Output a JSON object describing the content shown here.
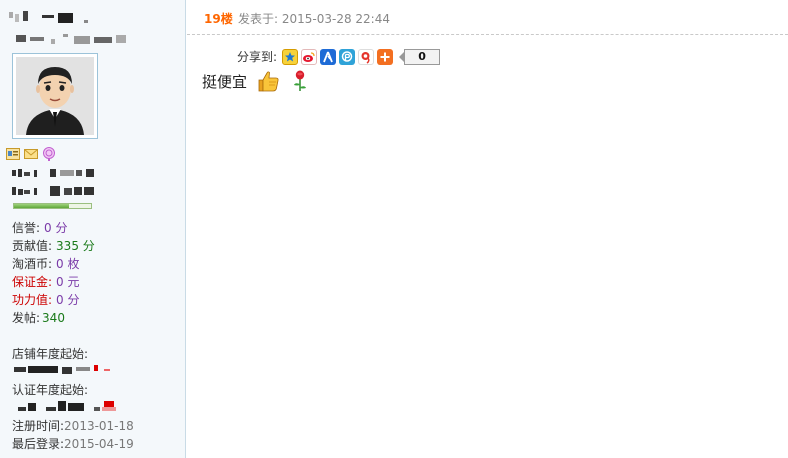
{
  "post": {
    "floor": "19楼",
    "posted_at": "发表于: 2015-03-28 22:44",
    "share_label": "分享到:",
    "share_count": "0",
    "share_icons": [
      "qzone-icon",
      "weibo-icon",
      "renren-icon",
      "pengyou-icon",
      "kaixin-icon",
      "more-share-icon"
    ],
    "content": "挺便宜",
    "emoticons": [
      "thumbs-up-icon",
      "rose-icon"
    ]
  },
  "user": {
    "stats": [
      {
        "key": "信誉:",
        "value": "0 分",
        "style": "normal"
      },
      {
        "key": "贡献值:",
        "value": "335 分",
        "style": "green"
      },
      {
        "key": "淘酒币:",
        "value": "0 枚",
        "style": "normal"
      },
      {
        "key": "保证金:",
        "value": "0 元",
        "style": "red"
      },
      {
        "key": "功力值:",
        "value": "0 分",
        "style": "red"
      },
      {
        "key": "发帖:",
        "value": "340",
        "style": "green"
      }
    ],
    "shop_year_label": "店铺年度起始:",
    "cert_year_label": "认证年度起始:",
    "registered_label": "注册时间:",
    "registered_value": "2013-01-18",
    "last_login_label": "最后登录:",
    "last_login_value": "2015-04-19",
    "level_progress": 0.72,
    "profile_icons": [
      "profile-card-icon",
      "message-icon",
      "follow-icon"
    ]
  },
  "colors": {
    "floor": "#ff6600",
    "accent_green": "#1a7a1a",
    "accent_red": "#cc0000",
    "value_purple": "#7a3aa8"
  }
}
